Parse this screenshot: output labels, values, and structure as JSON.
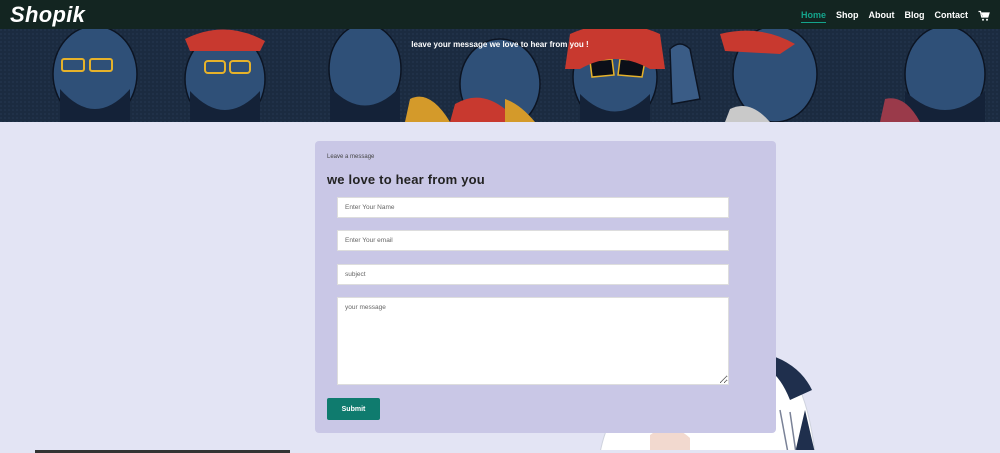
{
  "brand": {
    "logo": "Shopik"
  },
  "nav": {
    "items": [
      {
        "label": "Home",
        "active": true
      },
      {
        "label": "Shop",
        "active": false
      },
      {
        "label": "About",
        "active": false
      },
      {
        "label": "Blog",
        "active": false
      },
      {
        "label": "Contact",
        "active": false
      }
    ],
    "cart_icon": "cart-icon"
  },
  "hero": {
    "text": "leave your message we love to hear from you !"
  },
  "form": {
    "kicker": "Leave a message",
    "title": "we love to hear from you",
    "name_placeholder": "Enter Your Name",
    "email_placeholder": "Enter Your email",
    "subject_placeholder": "subject",
    "message_placeholder": "your message",
    "submit_label": "Submit"
  },
  "colors": {
    "navbar": "#132521",
    "accent": "#14a48c",
    "page_bg": "#e3e4f4",
    "card_bg": "#c9c7e6",
    "button": "#0f7b6e"
  }
}
